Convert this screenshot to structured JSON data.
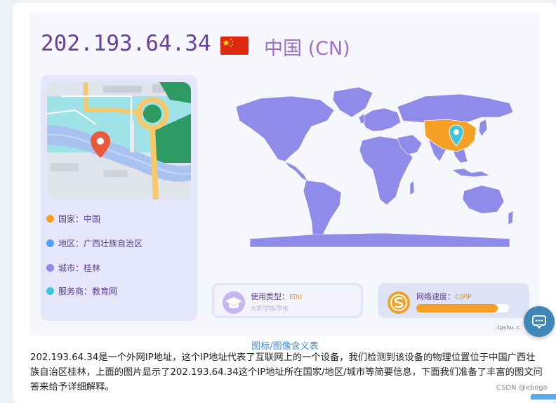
{
  "ip_card": {
    "ip_address": "202.193.64.34",
    "country_display": "中国 (CN)",
    "flag_icon": "china-flag"
  },
  "details": {
    "country": "国家：中国",
    "region": "地区：广西壮族自治区",
    "city": "城市：桂林",
    "isp": "服务商：教育网",
    "dot_colors": [
      "#f5a025",
      "#4da3ec",
      "#8f8be8",
      "#3ec6d8"
    ]
  },
  "usage": {
    "label": "使用类型：",
    "value": "EDU",
    "sub": "大学/学院/学校",
    "icon": "graduation-cap-icon"
  },
  "speed": {
    "label": "网络速度：",
    "value": "COMP",
    "icon": "speed-s-icon",
    "fill_fraction": 0.88
  },
  "watermark": "ipshu.c",
  "caption": "图标/图像含义表",
  "paragraph": "202.193.64.34是一个外网IP地址，这个IP地址代表了互联网上的一个设备，我们检测到该设备的物理位置位于中国广西壮族自治区桂林，上面的图片显示了202.193.64.34这个IP地址所在国家/地区/城市等简要信息，下面我们准备了丰富的图文问答来给予详细解释。",
  "footer_credit": "CSDN @ebogo",
  "colors": {
    "map_land": "#8f8be8",
    "highlight_country": "#f5a025",
    "ip_text": "#6a3fa0",
    "accent_orange": "#f5a025",
    "link_blue": "#3b8be0"
  }
}
